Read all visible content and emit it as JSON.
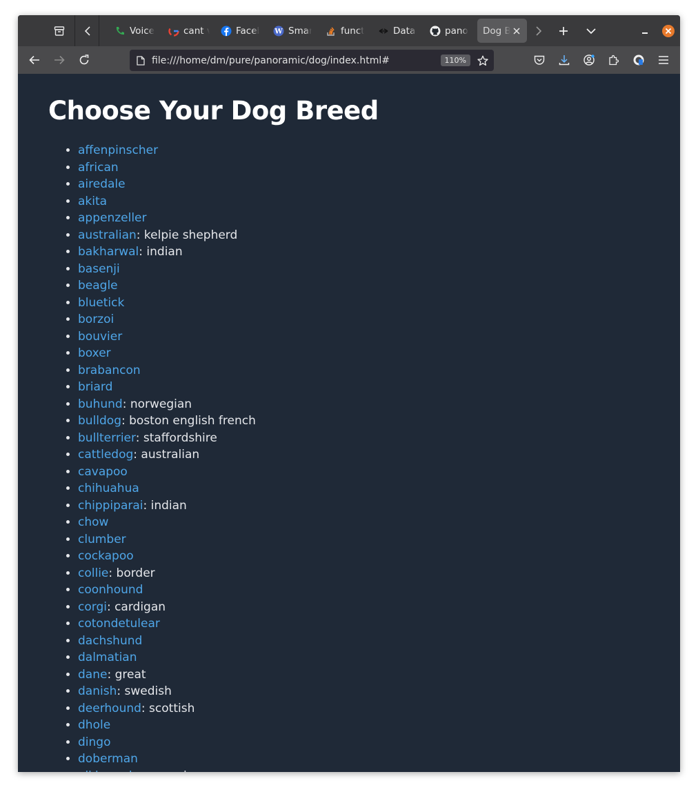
{
  "browser": {
    "tabs": [
      {
        "title": "Voice",
        "icon": "voice-icon"
      },
      {
        "title": "cant v",
        "icon": "google-icon"
      },
      {
        "title": "Faceb",
        "icon": "facebook-icon"
      },
      {
        "title": "Smar",
        "icon": "wordpress-icon"
      },
      {
        "title": "funct",
        "icon": "stackoverflow-icon"
      },
      {
        "title": "Data.",
        "icon": "datasette-icon"
      },
      {
        "title": "pano",
        "icon": "github-icon"
      }
    ],
    "active_tab": {
      "title": "Dog Br"
    },
    "url": "file:///home/dm/pure/panoramic/dog/index.html#",
    "zoom": "110%"
  },
  "page": {
    "title": "Choose Your Dog Breed",
    "breeds": [
      {
        "name": "affenpinscher",
        "sub": ""
      },
      {
        "name": "african",
        "sub": ""
      },
      {
        "name": "airedale",
        "sub": ""
      },
      {
        "name": "akita",
        "sub": ""
      },
      {
        "name": "appenzeller",
        "sub": ""
      },
      {
        "name": "australian",
        "sub": ": kelpie shepherd"
      },
      {
        "name": "bakharwal",
        "sub": ": indian"
      },
      {
        "name": "basenji",
        "sub": ""
      },
      {
        "name": "beagle",
        "sub": ""
      },
      {
        "name": "bluetick",
        "sub": ""
      },
      {
        "name": "borzoi",
        "sub": ""
      },
      {
        "name": "bouvier",
        "sub": ""
      },
      {
        "name": "boxer",
        "sub": ""
      },
      {
        "name": "brabancon",
        "sub": ""
      },
      {
        "name": "briard",
        "sub": ""
      },
      {
        "name": "buhund",
        "sub": ": norwegian"
      },
      {
        "name": "bulldog",
        "sub": ": boston english french"
      },
      {
        "name": "bullterrier",
        "sub": ": staffordshire"
      },
      {
        "name": "cattledog",
        "sub": ": australian"
      },
      {
        "name": "cavapoo",
        "sub": ""
      },
      {
        "name": "chihuahua",
        "sub": ""
      },
      {
        "name": "chippiparai",
        "sub": ": indian"
      },
      {
        "name": "chow",
        "sub": ""
      },
      {
        "name": "clumber",
        "sub": ""
      },
      {
        "name": "cockapoo",
        "sub": ""
      },
      {
        "name": "collie",
        "sub": ": border"
      },
      {
        "name": "coonhound",
        "sub": ""
      },
      {
        "name": "corgi",
        "sub": ": cardigan"
      },
      {
        "name": "cotondetulear",
        "sub": ""
      },
      {
        "name": "dachshund",
        "sub": ""
      },
      {
        "name": "dalmatian",
        "sub": ""
      },
      {
        "name": "dane",
        "sub": ": great"
      },
      {
        "name": "danish",
        "sub": ": swedish"
      },
      {
        "name": "deerhound",
        "sub": ": scottish"
      },
      {
        "name": "dhole",
        "sub": ""
      },
      {
        "name": "dingo",
        "sub": ""
      },
      {
        "name": "doberman",
        "sub": ""
      },
      {
        "name": "elkhound",
        "sub": ": norwegian"
      }
    ]
  },
  "colors": {
    "link": "#4fa6e8",
    "background": "#1f2937",
    "heading": "#ffffff"
  }
}
